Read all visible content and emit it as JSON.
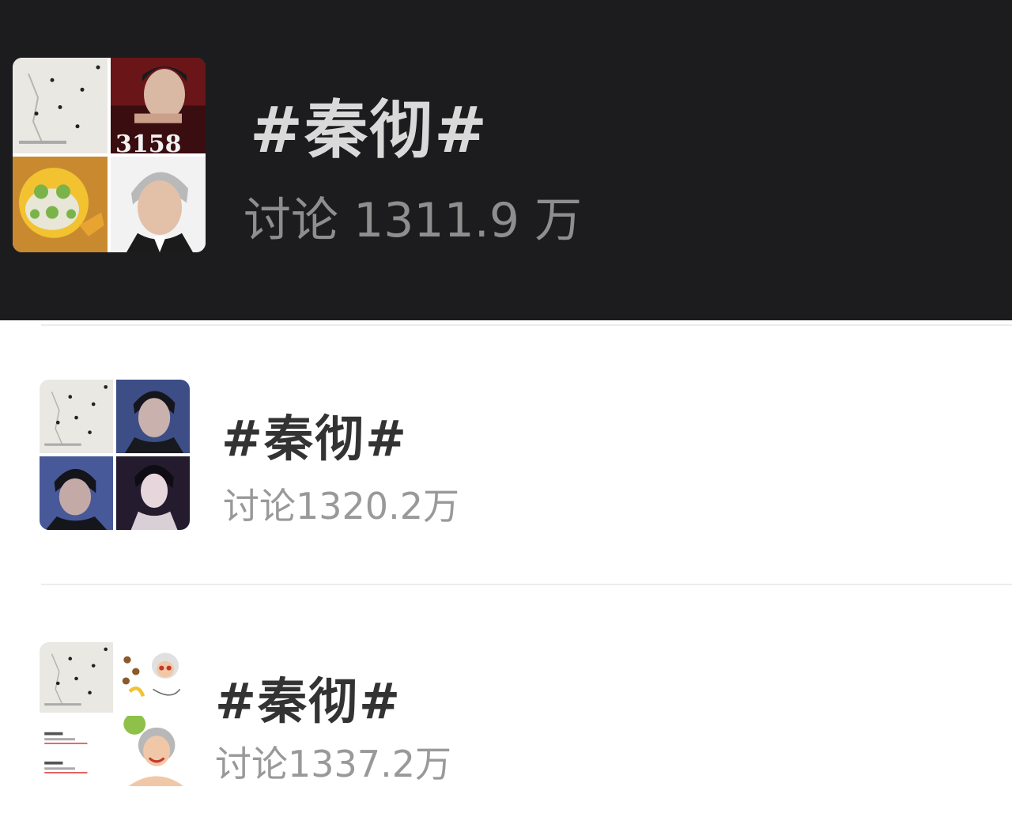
{
  "topics": [
    {
      "title": "#秦彻#",
      "discussion": "讨论 1311.9 万"
    },
    {
      "title": "#秦彻#",
      "discussion": "讨论1320.2万"
    },
    {
      "title": "#秦彻#",
      "discussion": "讨论1337.2万"
    }
  ],
  "thumbnails": {
    "topic1": [
      "paper-photo",
      "man-portrait-3158-cover",
      "emoji-face-mask",
      "silver-hair-man-portrait"
    ],
    "topic2": [
      "paper-photo",
      "dark-hair-man-portrait",
      "dark-hair-man-portrait",
      "dark-hair-man-portrait-purple"
    ],
    "topic3": [
      "paper-photo",
      "sticker-grandma-emojis",
      "list-screenshot",
      "sticker-grandma-face-mask"
    ]
  },
  "colors": {
    "dark_background": "#1c1c1e",
    "dark_title": "#d9d9d9",
    "dark_meta": "#8e8e8e",
    "light_title": "#333333",
    "light_meta": "#999999"
  }
}
